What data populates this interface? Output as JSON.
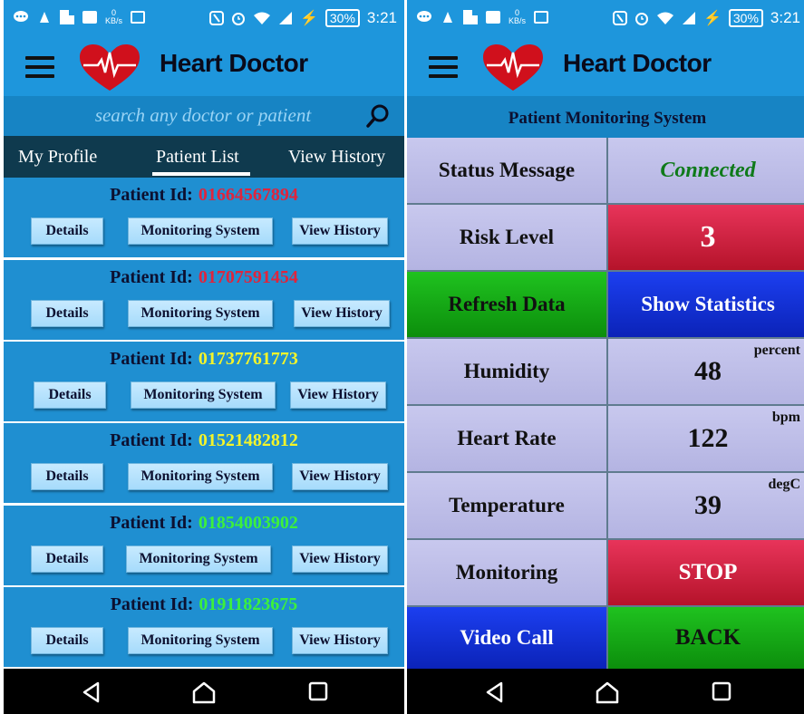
{
  "app": {
    "title": "Heart Doctor"
  },
  "status_bar": {
    "kbs_value": "0",
    "kbs_unit": "KB/s",
    "battery": "30%",
    "time": "3:21"
  },
  "search": {
    "placeholder": "search any doctor or patient",
    "value": ""
  },
  "tabs": [
    {
      "label": "My Profile"
    },
    {
      "label": "Patient List",
      "active": true
    },
    {
      "label": "View History"
    }
  ],
  "patients": [
    {
      "label": "Patient Id:",
      "id": "01664567894",
      "id_color": "#e0243c"
    },
    {
      "label": "Patient Id:",
      "id": "01707591454",
      "id_color": "#e0243c"
    },
    {
      "label": "Patient Id:",
      "id": "01737761773",
      "id_color": "#f4f42a"
    },
    {
      "label": "Patient Id:",
      "id": "01521482812",
      "id_color": "#f4f42a"
    },
    {
      "label": "Patient Id:",
      "id": "01854003902",
      "id_color": "#3cf03c"
    },
    {
      "label": "Patient Id:",
      "id": "01911823675",
      "id_color": "#3cf03c"
    }
  ],
  "patient_buttons": {
    "details": "Details",
    "monitoring": "Monitoring System",
    "history": "View History"
  },
  "monitor": {
    "header": "Patient Monitoring System",
    "status_label": "Status Message",
    "status_value": "Connected",
    "risk_label": "Risk Level",
    "risk_value": "3",
    "refresh_label": "Refresh Data",
    "stats_label": "Show Statistics",
    "humidity_label": "Humidity",
    "humidity_value": "48",
    "humidity_unit": "percent",
    "heart_label": "Heart Rate",
    "heart_value": "122",
    "heart_unit": "bpm",
    "temp_label": "Temperature",
    "temp_value": "39",
    "temp_unit": "degC",
    "monitoring_label": "Monitoring",
    "stop_label": "STOP",
    "video_label": "Video Call",
    "back_label": "BACK"
  },
  "colors": {
    "appbar": "#1e96dc",
    "tabs_bg": "#0f3a4e",
    "card_bg": "#1f8fd1",
    "connected": "#0f7a1a"
  },
  "icons": [
    "menu-icon",
    "heart-logo-icon",
    "search-icon",
    "back-nav-icon",
    "home-nav-icon",
    "recents-nav-icon"
  ]
}
